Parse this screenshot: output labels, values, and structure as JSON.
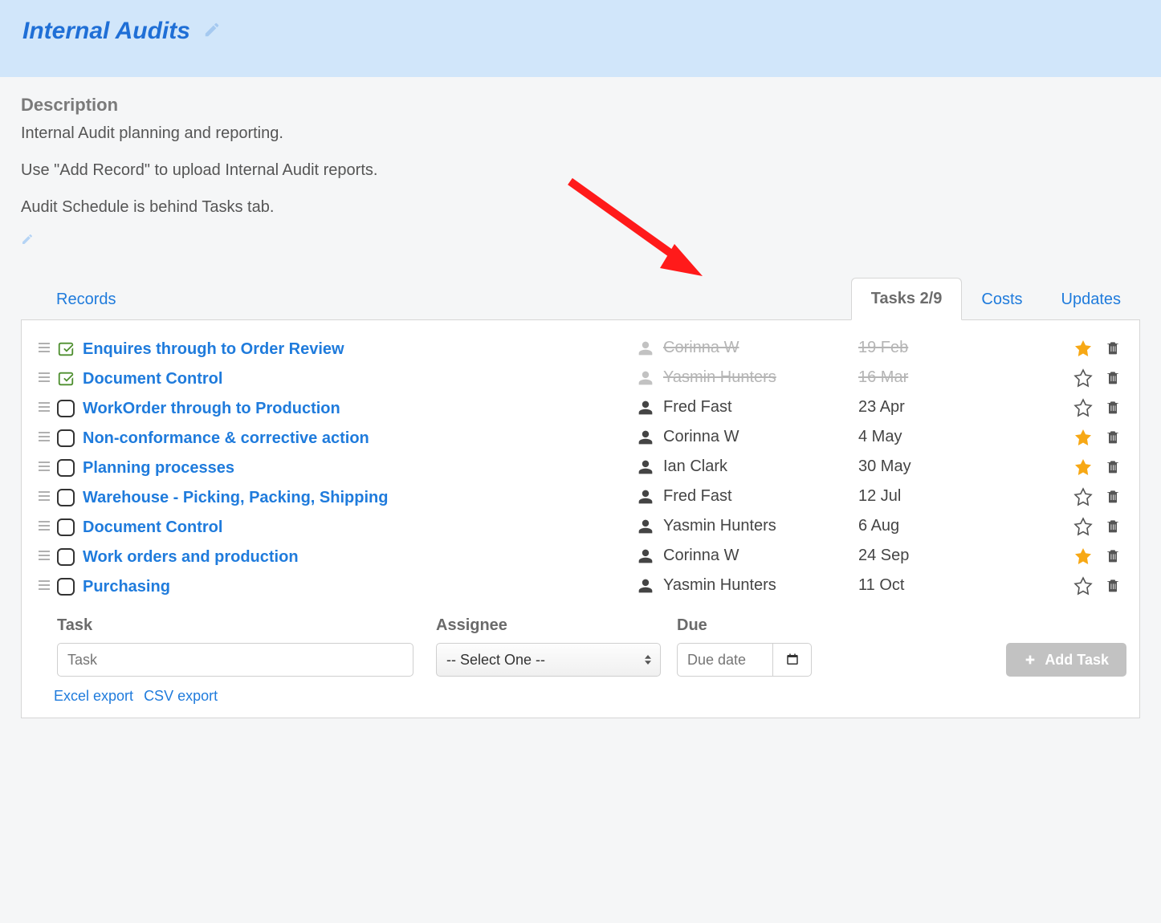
{
  "header": {
    "title": "Internal Audits"
  },
  "description": {
    "label": "Description",
    "line1": "Internal Audit planning and reporting.",
    "line2": "Use \"Add Record\" to upload Internal Audit reports.",
    "line3": "Audit Schedule is behind Tasks tab."
  },
  "tabs": {
    "records": "Records",
    "tasks": "Tasks 2/9",
    "costs": "Costs",
    "updates": "Updates"
  },
  "tasks": [
    {
      "name": "Enquires through to Order Review",
      "assignee": "Corinna W",
      "due": "19 Feb",
      "done": true,
      "starred": true
    },
    {
      "name": "Document Control",
      "assignee": "Yasmin Hunters",
      "due": "16 Mar",
      "done": true,
      "starred": false
    },
    {
      "name": "WorkOrder through to Production",
      "assignee": "Fred Fast",
      "due": "23 Apr",
      "done": false,
      "starred": false
    },
    {
      "name": "Non-conformance & corrective action",
      "assignee": "Corinna W",
      "due": "4 May",
      "done": false,
      "starred": true
    },
    {
      "name": "Planning processes",
      "assignee": "Ian Clark",
      "due": "30 May",
      "done": false,
      "starred": true
    },
    {
      "name": "Warehouse - Picking, Packing, Shipping",
      "assignee": "Fred Fast",
      "due": "12 Jul",
      "done": false,
      "starred": false
    },
    {
      "name": "Document Control",
      "assignee": "Yasmin Hunters",
      "due": "6 Aug",
      "done": false,
      "starred": false
    },
    {
      "name": "Work orders and production",
      "assignee": "Corinna W",
      "due": "24 Sep",
      "done": false,
      "starred": true
    },
    {
      "name": "Purchasing",
      "assignee": "Yasmin Hunters",
      "due": "11 Oct",
      "done": false,
      "starred": false
    }
  ],
  "form": {
    "task_label": "Task",
    "task_placeholder": "Task",
    "assignee_label": "Assignee",
    "assignee_placeholder": "-- Select One --",
    "due_label": "Due",
    "due_placeholder": "Due date",
    "add_button": "Add Task"
  },
  "exports": {
    "excel": "Excel export",
    "csv": "CSV export"
  }
}
